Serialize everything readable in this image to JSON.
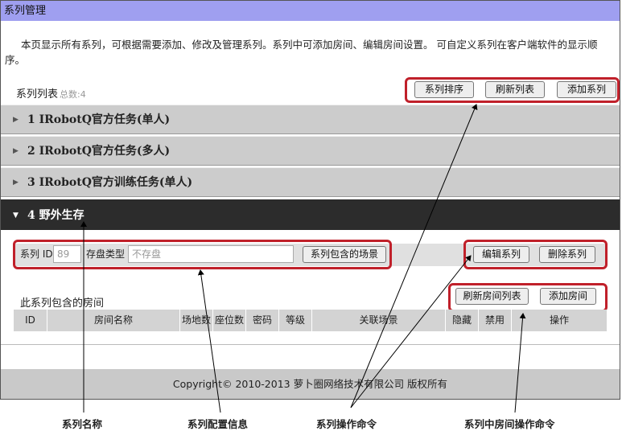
{
  "title_bar": "系列管理",
  "intro": "本页显示所有系列，可根据需要添加、修改及管理系列。系列中可添加房间、编辑房间设置。 可自定义系列在客户端软件的显示顺序。",
  "list": {
    "label": "系列列表",
    "count": "总数:4"
  },
  "toolbar": {
    "sort": "系列排序",
    "refresh": "刷新列表",
    "add": "添加系列"
  },
  "series": [
    {
      "label": "1 IRobotQ官方任务(单人)"
    },
    {
      "label": "2 IRobotQ官方任务(多人)"
    },
    {
      "label": "3 IRobotQ官方训练任务(单人)"
    },
    {
      "label": "4 野外生存"
    }
  ],
  "icons": {
    "collapsed": "caret-right-icon",
    "expanded": "caret-down-icon"
  },
  "form": {
    "id_label": "系列 ID",
    "id_value": "89",
    "storage_label": "存盘类型",
    "storage_placeholder": "不存盘",
    "scenes_button": "系列包含的场景",
    "edit_button": "编辑系列",
    "delete_button": "删除系列"
  },
  "rooms": {
    "title": "此系列包含的房间",
    "refresh_button": "刷新房间列表",
    "add_button": "添加房间",
    "columns": [
      "ID",
      "房间名称",
      "场地数",
      "座位数",
      "密码",
      "等级",
      "关联场景",
      "隐藏",
      "禁用",
      "操作"
    ]
  },
  "footer": "Copyright© 2010-2013 萝卜圈网络技术有限公司 版权所有",
  "annotations": [
    "系列名称",
    "系列配置信息",
    "系列操作命令",
    "系列中房间操作命令"
  ],
  "colors": {
    "title_bar": "#9f9ff0",
    "highlight": "#c0202a",
    "active_row": "#2c2c2c"
  }
}
